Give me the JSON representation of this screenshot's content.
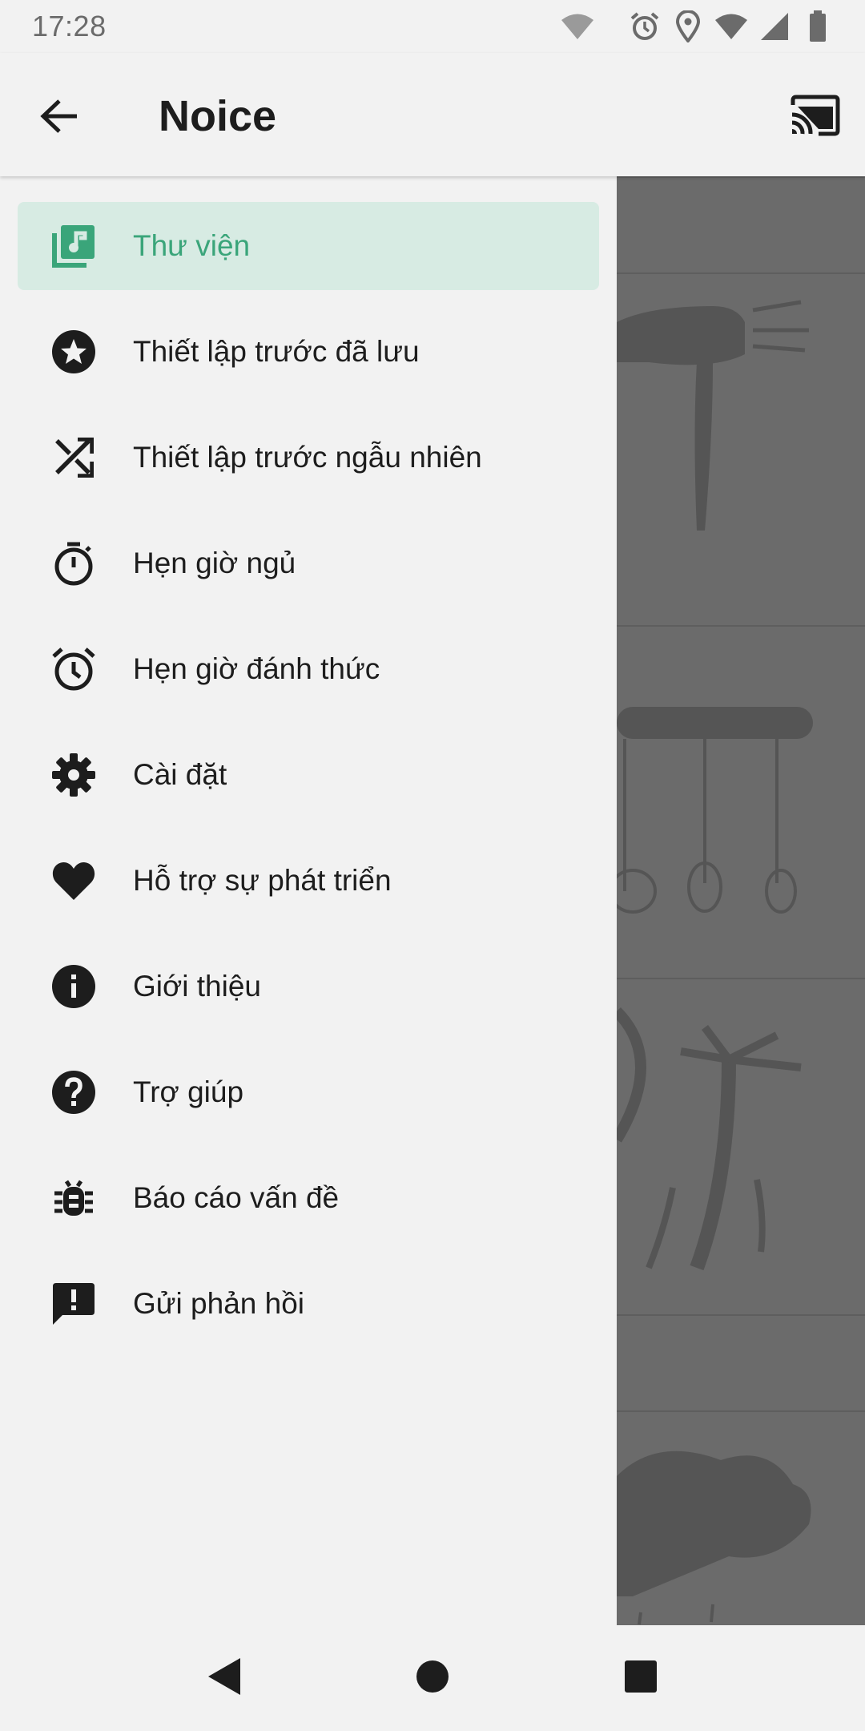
{
  "status_bar": {
    "time": "17:28",
    "icons": [
      "wifi-dim-icon",
      "alarm-icon",
      "location-icon",
      "wifi-icon",
      "signal-icon",
      "battery-icon"
    ]
  },
  "app_bar": {
    "title": "Noice",
    "back_icon": "arrow-back-icon",
    "cast_icon": "cast-icon"
  },
  "drawer": {
    "items": [
      {
        "label": "Thư viện",
        "icon": "library-music-icon",
        "active": true
      },
      {
        "label": "Thiết lập trước đã lưu",
        "icon": "star-circle-icon",
        "active": false
      },
      {
        "label": "Thiết lập trước ngẫu nhiên",
        "icon": "shuffle-icon",
        "active": false
      },
      {
        "label": "Hẹn giờ ngủ",
        "icon": "timer-icon",
        "active": false
      },
      {
        "label": "Hẹn giờ đánh thức",
        "icon": "alarm-clock-icon",
        "active": false
      },
      {
        "label": "Cài đặt",
        "icon": "gear-icon",
        "active": false
      },
      {
        "label": "Hỗ trợ sự phát triển",
        "icon": "heart-icon",
        "active": false
      },
      {
        "label": "Giới thiệu",
        "icon": "info-icon",
        "active": false
      },
      {
        "label": "Trợ giúp",
        "icon": "help-icon",
        "active": false
      },
      {
        "label": "Báo cáo vấn đề",
        "icon": "bug-icon",
        "active": false
      },
      {
        "label": "Gửi phản hồi",
        "icon": "feedback-icon",
        "active": false
      }
    ]
  },
  "colors": {
    "accent": "#3aa57a",
    "active_bg": "#d7ebe3",
    "drawer_bg": "#f2f2f2",
    "scrim": "#6b6b6b"
  },
  "nav_bar": {
    "icons": [
      "back-triangle-icon",
      "home-circle-icon",
      "recents-square-icon"
    ]
  }
}
